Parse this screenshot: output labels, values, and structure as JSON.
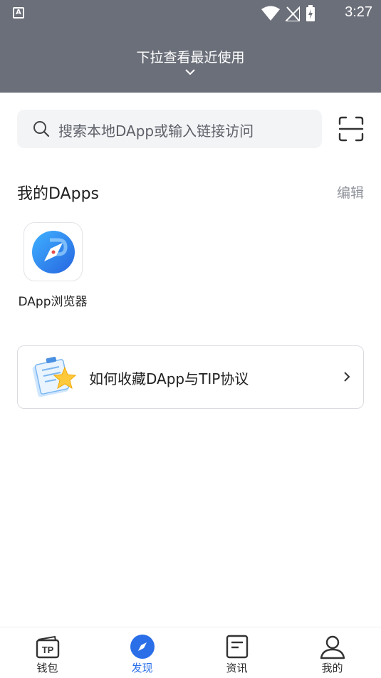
{
  "status_bar": {
    "time": "3:27",
    "app_icon": "A"
  },
  "pull_header": {
    "text": "下拉查看最近使用"
  },
  "search": {
    "placeholder": "搜索本地DApp或输入链接访问"
  },
  "my_dapps": {
    "title": "我的DApps",
    "edit_label": "编辑",
    "items": [
      {
        "label": "DApp浏览器",
        "icon": "compass-icon"
      }
    ]
  },
  "guide_card": {
    "text": "如何收藏DApp与TIP协议"
  },
  "bottom_nav": {
    "items": [
      {
        "label": "钱包",
        "icon": "wallet-icon",
        "active": false
      },
      {
        "label": "发现",
        "icon": "compass-icon",
        "active": true
      },
      {
        "label": "资讯",
        "icon": "news-icon",
        "active": false
      },
      {
        "label": "我的",
        "icon": "user-icon",
        "active": false
      }
    ]
  },
  "colors": {
    "header_bg": "#6b6f79",
    "accent": "#2a6fe8",
    "search_bg": "#f3f4f6"
  }
}
